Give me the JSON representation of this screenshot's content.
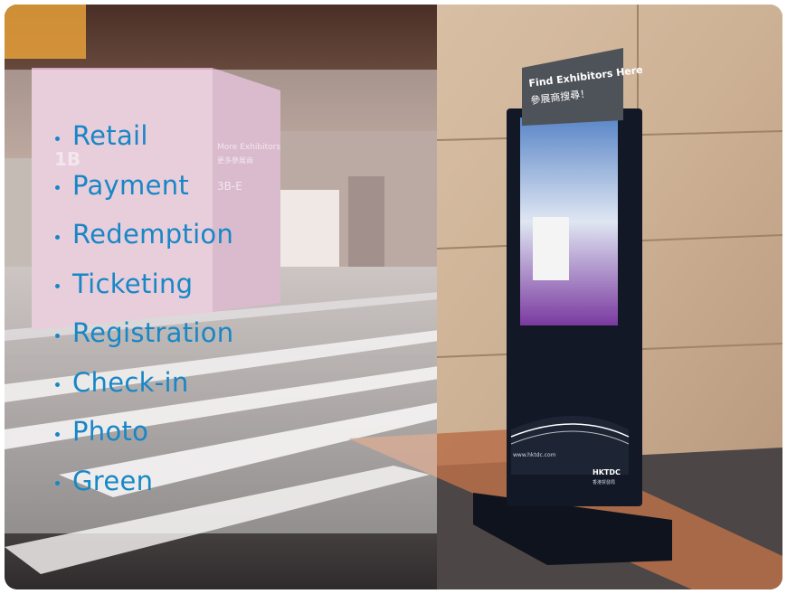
{
  "features": [
    "Retail",
    "Payment",
    "Redemption",
    "Ticketing",
    "Registration",
    "Check-in",
    "Photo",
    "Green"
  ],
  "kiosk": {
    "header_title": "Find Exhibitors Here",
    "header_subtitle": "參展商搜尋！",
    "url_text": "www.hktdc.com",
    "brand": "HKTDC",
    "brand_sub": "香港貿發局"
  },
  "pillar": {
    "big_label": "1B",
    "more_label": "More Exhibitors",
    "more_sub": "更多參展商",
    "hall_label": "3B-E"
  },
  "colors": {
    "feature_text": "#1787c6",
    "kiosk_body": "#121826",
    "kiosk_header": "#4e5259"
  }
}
